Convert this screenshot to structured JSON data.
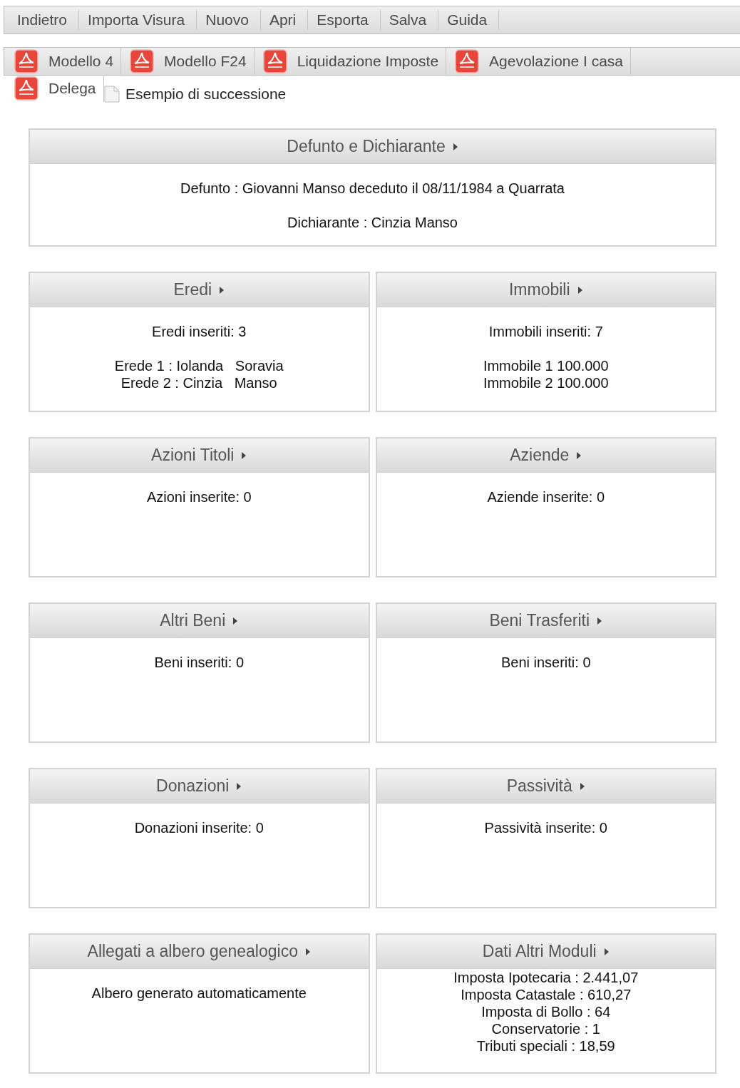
{
  "toolbar": [
    "Indietro",
    "Importa Visura",
    "Nuovo",
    "Apri",
    "Esporta",
    "Salva",
    "Guida"
  ],
  "documents": [
    "Modello 4",
    "Modello F24",
    "Liquidazione Imposte",
    "Agevolazione I casa",
    "Delega"
  ],
  "file": {
    "name": "Esempio di successione"
  },
  "panels": [
    {
      "title": "Defunto e Dichiarante",
      "wide": true,
      "compact": false,
      "blocks": [
        [
          "Defunto : Giovanni Manso deceduto il 08/11/1984 a Quarrata"
        ],
        [
          "Dichiarante : Cinzia Manso"
        ]
      ]
    },
    {
      "title": "Eredi",
      "wide": false,
      "compact": false,
      "blocks": [
        [
          "Eredi inseriti: 3"
        ],
        [
          "Erede 1 : Iolanda   Soravia",
          "Erede 2 : Cinzia   Manso"
        ]
      ]
    },
    {
      "title": "Immobili",
      "wide": false,
      "compact": false,
      "blocks": [
        [
          "Immobili inseriti: 7"
        ],
        [
          "Immobile 1 100.000",
          "Immobile 2 100.000"
        ]
      ]
    },
    {
      "title": "Azioni Titoli",
      "wide": false,
      "compact": false,
      "blocks": [
        [
          "Azioni inserite: 0"
        ]
      ]
    },
    {
      "title": "Aziende",
      "wide": false,
      "compact": false,
      "blocks": [
        [
          "Aziende inserite: 0"
        ]
      ]
    },
    {
      "title": "Altri Beni",
      "wide": false,
      "compact": false,
      "blocks": [
        [
          "Beni inseriti: 0"
        ]
      ]
    },
    {
      "title": "Beni Trasferiti",
      "wide": false,
      "compact": false,
      "blocks": [
        [
          "Beni inseriti: 0"
        ]
      ]
    },
    {
      "title": "Donazioni",
      "wide": false,
      "compact": false,
      "blocks": [
        [
          "Donazioni inserite: 0"
        ]
      ]
    },
    {
      "title": "Passività",
      "wide": false,
      "compact": false,
      "blocks": [
        [
          "Passività inserite: 0"
        ]
      ]
    },
    {
      "title": "Allegati a albero genealogico",
      "wide": false,
      "compact": false,
      "blocks": [
        [
          "Albero generato automaticamente"
        ]
      ]
    },
    {
      "title": "Dati Altri Moduli",
      "wide": false,
      "compact": true,
      "blocks": [
        [
          "Imposta Ipotecaria : 2.441,07",
          "Imposta Catastale : 610,27",
          "Imposta di Bollo : 64",
          "Conservatorie : 1",
          "Tributi speciali : 18,59"
        ]
      ]
    }
  ]
}
